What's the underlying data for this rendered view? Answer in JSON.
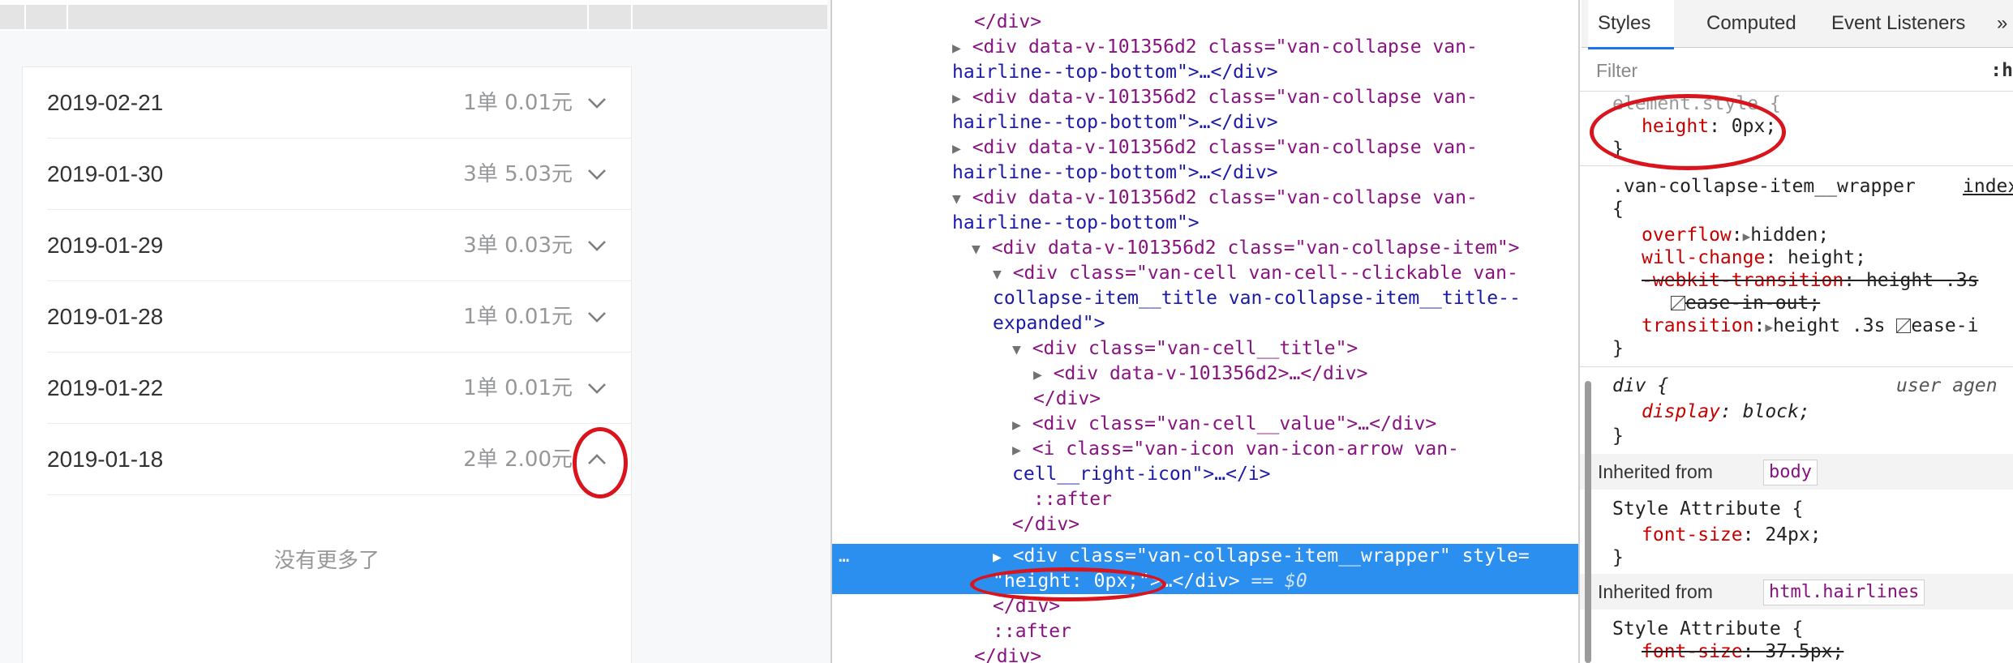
{
  "preview": {
    "rows": [
      {
        "date": "2019-02-21",
        "value": "1单 0.01元",
        "expanded": false
      },
      {
        "date": "2019-01-30",
        "value": "3单 5.03元",
        "expanded": false
      },
      {
        "date": "2019-01-29",
        "value": "3单 0.03元",
        "expanded": false
      },
      {
        "date": "2019-01-28",
        "value": "1单 0.01元",
        "expanded": false
      },
      {
        "date": "2019-01-22",
        "value": "1单 0.01元",
        "expanded": false
      },
      {
        "date": "2019-01-18",
        "value": "2单 2.00元",
        "expanded": true
      }
    ],
    "no_more": "没有更多了",
    "annotation_color": "#d9141d"
  },
  "elements": {
    "lines": [
      "</div>",
      "<div data-v-101356d2 class=\"van-collapse van-",
      "hairline--top-bottom\">…</div>",
      "<div data-v-101356d2 class=\"van-collapse van-",
      "hairline--top-bottom\">…</div>",
      "<div data-v-101356d2 class=\"van-collapse van-",
      "hairline--top-bottom\">…</div>",
      "<div data-v-101356d2 class=\"van-collapse van-",
      "hairline--top-bottom\">",
      "<div data-v-101356d2 class=\"van-collapse-item\">",
      "<div class=\"van-cell van-cell--clickable van-",
      "collapse-item__title van-collapse-item__title--",
      "expanded\">",
      "<div class=\"van-cell__title\">",
      "<div data-v-101356d2>…</div>",
      "</div>",
      "<div class=\"van-cell__value\">…</div>",
      "<i class=\"van-icon van-icon-arrow van-",
      "cell__right-icon\">…</i>",
      "::after",
      "</div>"
    ],
    "selected_line_1": "<div class=\"van-collapse-item__wrapper\" style=",
    "selected_line_2a": "\"height: 0px;\">",
    "selected_line_2b": "…</div>",
    "selected_eq": " == $0",
    "selected_dots": "…",
    "after_lines": [
      "</div>",
      "::after",
      "</div>"
    ],
    "selection_color": "#2b8ff0"
  },
  "styles": {
    "tabs": [
      "Styles",
      "Computed",
      "Event Listeners",
      "»"
    ],
    "active_tab": "Styles",
    "filter_placeholder": "Filter",
    "filter_hov": ":h",
    "element_style": {
      "selector": "element.style {",
      "prop": "height",
      "value": "0px;",
      "close": "}"
    },
    "wrapper_rule": {
      "selector": ".van-collapse-item__wrapper",
      "source": "index",
      "open": "{",
      "props": [
        {
          "name": "overflow",
          "value": "hidden;",
          "strike": false
        },
        {
          "name": "will-change",
          "value": "height;",
          "strike": false
        },
        {
          "name": "-webkit-transition",
          "value": "height .3s",
          "strike": true
        },
        {
          "name": "",
          "value": "ease-in-out;",
          "strike": true
        },
        {
          "name": "transition",
          "value": "height .3s",
          "strike": false,
          "extra": "ease-i"
        }
      ],
      "close": "}"
    },
    "div_rule": {
      "selector": "div {",
      "source": "user agen",
      "prop": "display",
      "value": "block;",
      "close": "}"
    },
    "inherited_body": {
      "label": "Inherited from",
      "chip": "body"
    },
    "body_rule": {
      "selector": "Style Attribute {",
      "prop": "font-size",
      "value": "24px;",
      "close": "}"
    },
    "inherited_html": {
      "label": "Inherited from",
      "chip": "html.hairlines"
    },
    "html_rule": {
      "selector": "Style Attribute {",
      "prop": "font-size",
      "value": "37.5px;"
    }
  }
}
